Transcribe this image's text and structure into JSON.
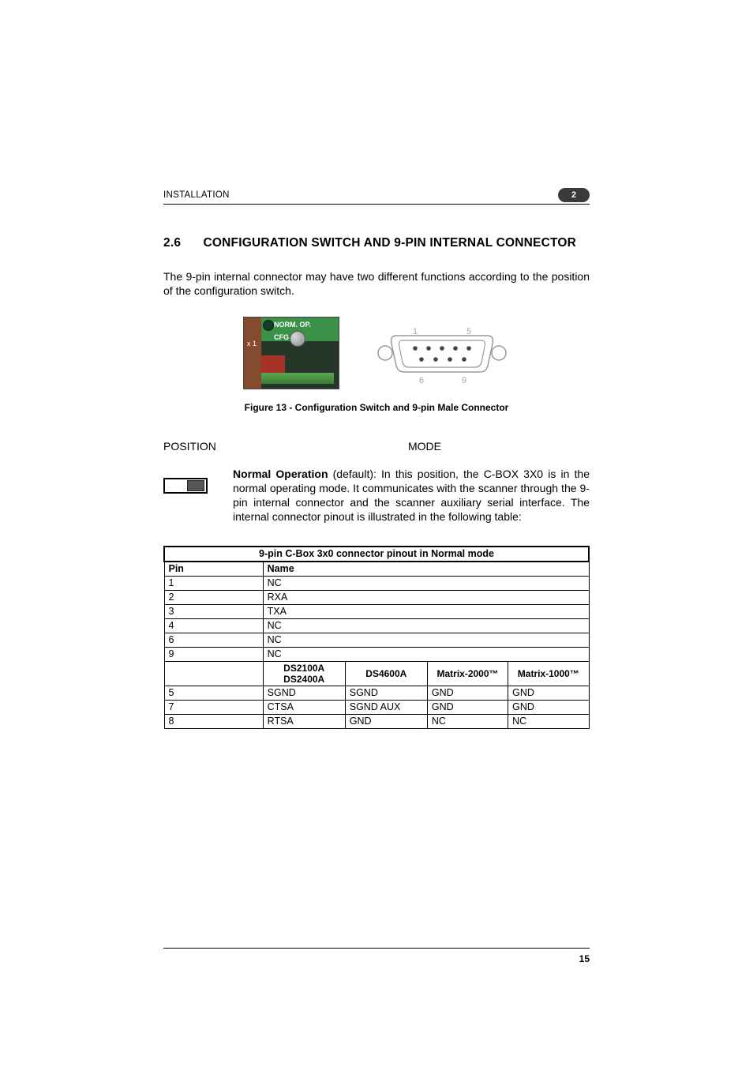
{
  "header": {
    "section": "INSTALLATION",
    "chapter_tab": "2"
  },
  "section": {
    "number": "2.6",
    "title": "CONFIGURATION SWITCH AND 9-PIN INTERNAL CONNECTOR"
  },
  "intro": "The 9-pin internal connector may have two different functions according to the position of the configuration switch.",
  "switch_labels": {
    "norm": "NORM. OP.",
    "cfg": "CFG",
    "x1": "x 1"
  },
  "dsub_labels": {
    "tl": "1",
    "tr": "5",
    "bl": "6",
    "br": "9"
  },
  "figure_caption": "Figure 13 - Configuration Switch and 9-pin Male Connector",
  "columns": {
    "position": "POSITION",
    "mode": "MODE"
  },
  "normal_mode": {
    "bold": "Normal Operation",
    "rest": " (default): In this position, the C-BOX 3X0 is in the normal operating mode. It communicates with the scanner through the 9-pin internal connector and the scanner auxiliary serial interface. The internal connector pinout is illustrated in the following table:"
  },
  "table": {
    "title": "9-pin C-Box 3x0 connector pinout in Normal mode",
    "head": {
      "pin": "Pin",
      "name": "Name"
    },
    "simple_rows": [
      {
        "pin": "1",
        "name": "NC"
      },
      {
        "pin": "2",
        "name": "RXA"
      },
      {
        "pin": "3",
        "name": "TXA"
      },
      {
        "pin": "4",
        "name": "NC"
      },
      {
        "pin": "6",
        "name": "NC"
      },
      {
        "pin": "9",
        "name": "NC"
      }
    ],
    "subhead": {
      "c0": "",
      "c1_l1": "DS2100A",
      "c1_l2": "DS2400A",
      "c2": "DS4600A",
      "c3": "Matrix-2000™",
      "c4": "Matrix-1000™"
    },
    "multi_rows": [
      {
        "pin": "5",
        "c1": "SGND",
        "c2": "SGND",
        "c3": "GND",
        "c4": "GND"
      },
      {
        "pin": "7",
        "c1": "CTSA",
        "c2": "SGND AUX",
        "c3": "GND",
        "c4": "GND"
      },
      {
        "pin": "8",
        "c1": "RTSA",
        "c2": "GND",
        "c3": "NC",
        "c4": "NC"
      }
    ]
  },
  "page_number": "15"
}
